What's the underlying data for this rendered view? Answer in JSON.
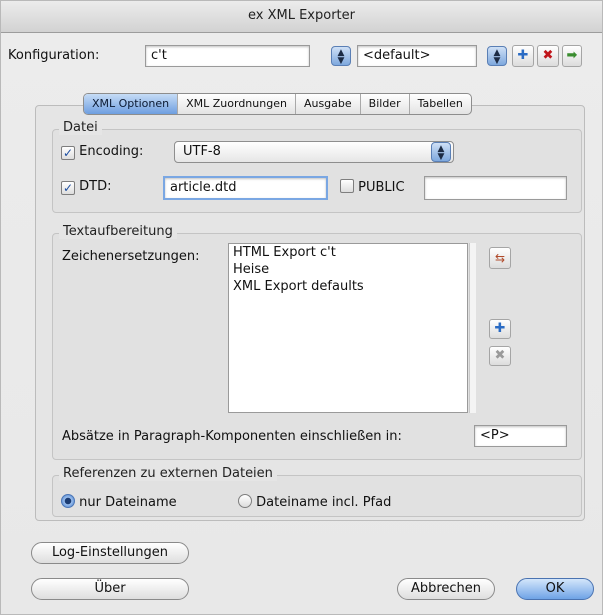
{
  "window": {
    "title": "ex XML Exporter"
  },
  "config": {
    "label": "Konfiguration:",
    "value": "c't",
    "preset_value": "<default>"
  },
  "tabs": [
    {
      "label": "XML Optionen",
      "active": true
    },
    {
      "label": "XML Zuordnungen",
      "active": false
    },
    {
      "label": "Ausgabe",
      "active": false
    },
    {
      "label": "Bilder",
      "active": false
    },
    {
      "label": "Tabellen",
      "active": false
    }
  ],
  "datei": {
    "group_label": "Datei",
    "encoding_label": "Encoding:",
    "encoding_checked": true,
    "encoding_value": "UTF-8",
    "dtd_label": "DTD:",
    "dtd_checked": true,
    "dtd_value": "article.dtd",
    "public_label": "PUBLIC",
    "public_checked": false,
    "public_value": ""
  },
  "text": {
    "group_label": "Textaufbereitung",
    "zeichen_label": "Zeichenersetzungen:",
    "items": [
      "HTML Export c't",
      "Heise",
      "XML Export defaults"
    ],
    "absatz_label": "Absätze in Paragraph-Komponenten einschließen in:",
    "absatz_value": "<P>"
  },
  "refs": {
    "group_label": "Referenzen zu externen Dateien",
    "option1": "nur Dateiname",
    "option2": "Dateiname incl. Pfad",
    "selected": "option1"
  },
  "buttons": {
    "log": "Log-Einstellungen",
    "about": "Über",
    "cancel": "Abbrechen",
    "ok": "OK"
  },
  "colors": {
    "accent": "#6fa3e6",
    "delete": "#c0151a"
  }
}
